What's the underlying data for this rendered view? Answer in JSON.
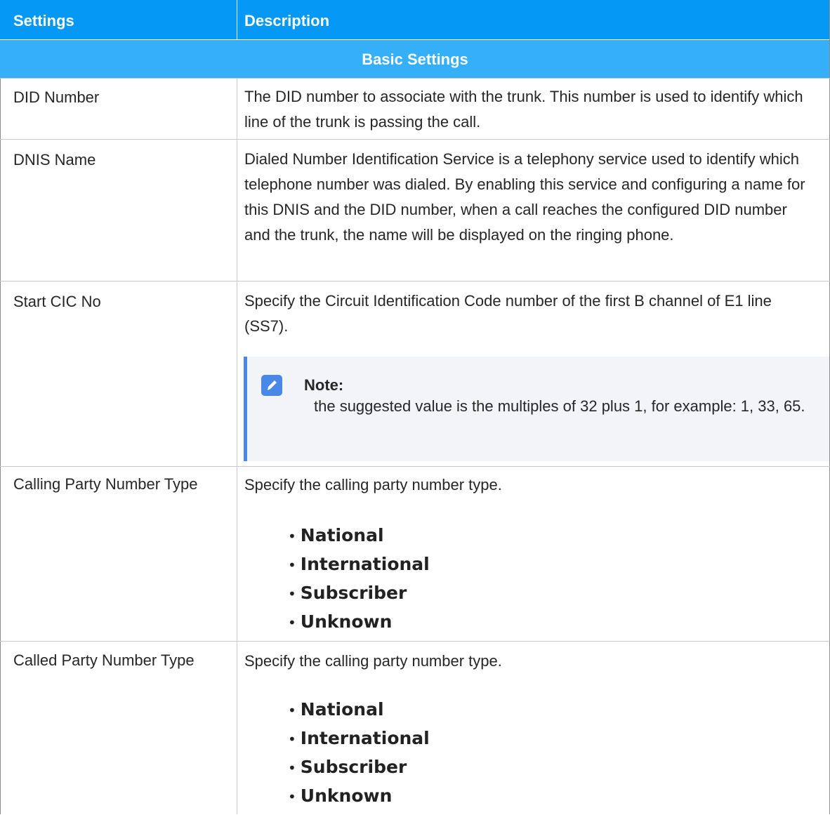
{
  "header": {
    "col1": "Settings",
    "col2": "Description"
  },
  "section": {
    "title": "Basic Settings"
  },
  "rows": [
    {
      "setting": "DID Number",
      "description": "The DID number to associate with the trunk. This number is used to identify which line of the trunk is passing the call."
    },
    {
      "setting": "DNIS Name",
      "description": "Dialed Number Identification Service is a telephony service used to identify which telephone number was dialed. By enabling this service and configuring a name for this DNIS and the DID number, when a call reaches the configured DID number and the trunk, the name will be displayed on the ringing phone."
    },
    {
      "setting": "Start CIC No",
      "description": "Specify the Circuit Identification Code number of the first B channel of E1 line (SS7).",
      "note": {
        "title": "Note:",
        "text": "the suggested value is the multiples of 32 plus 1, for example: 1, 33, 65."
      }
    },
    {
      "setting": "Calling Party Number Type",
      "description": "Specify the calling party number type.",
      "options": [
        "National",
        "International",
        "Subscriber",
        "Unknown"
      ]
    },
    {
      "setting": "Called Party Number Type",
      "description": "Specify the calling party number type.",
      "options": [
        "National",
        "International",
        "Subscriber",
        "Unknown"
      ]
    }
  ],
  "icons": {
    "note": "pencil-note-icon"
  },
  "colors": {
    "header_bg": "#0599f5",
    "section_bg": "#35aff7",
    "note_accent": "#4a88e8",
    "note_bg": "#f2f4f7"
  }
}
